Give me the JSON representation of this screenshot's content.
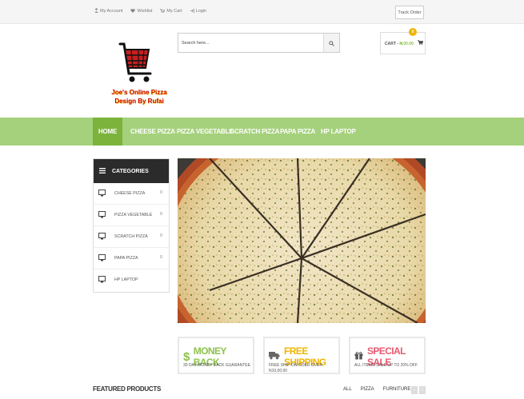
{
  "topbar": {
    "links": [
      {
        "icon": "user-icon",
        "label": "My Account"
      },
      {
        "icon": "heart-icon",
        "label": "Wishlist"
      },
      {
        "icon": "cart-icon",
        "label": "My Cart"
      },
      {
        "icon": "login-icon",
        "label": "Login"
      }
    ],
    "track_label": "Track Order"
  },
  "logo": {
    "line1": "Joe's Online Pizza",
    "line2": "Design By Rufai"
  },
  "search": {
    "placeholder": "Search here..."
  },
  "cart": {
    "label": "CART -",
    "total": "₦,00.00",
    "badge": "0"
  },
  "nav": {
    "items": [
      "HOME",
      "CHEESE PIZZA",
      "PIZZA VEGETABLE",
      "SCRATCH PIZZA",
      "PAPA PIZZA",
      "HP LAPTOP"
    ],
    "active": "HOME"
  },
  "categories": {
    "title": "CATEGORIES",
    "items": [
      {
        "label": "CHEESE PIZZA",
        "count": "0"
      },
      {
        "label": "PIZZA VEGETABLE",
        "count": "0"
      },
      {
        "label": "SCRATCH PIZZA",
        "count": "0"
      },
      {
        "label": "PAPA PIZZA",
        "count": "0"
      },
      {
        "label": "HP LAPTOP",
        "count": "0"
      }
    ]
  },
  "features": [
    {
      "icon": "dollar-icon",
      "title": "MONEY BACK",
      "subtitle": "30 DAY MONEY BACK GUARANTEE."
    },
    {
      "icon": "truck-icon",
      "title": "FREE SHIPPING",
      "subtitle": "FREE SHIP-ON ODER OVER N10,00.00"
    },
    {
      "icon": "gift-icon",
      "title": "SPECIAL SALE",
      "subtitle": "ALL ITEMS-SALE UP TO 20% OFF"
    }
  ],
  "featured": {
    "title": "FEATURED PRODUCTS",
    "filters": [
      "ALL",
      "PIZZA",
      "FURNITURE"
    ]
  },
  "colors": {
    "accent": "#a5d17c",
    "accent_dark": "#7bb33c",
    "badge": "#f0b400",
    "sale": "#e85a70"
  }
}
